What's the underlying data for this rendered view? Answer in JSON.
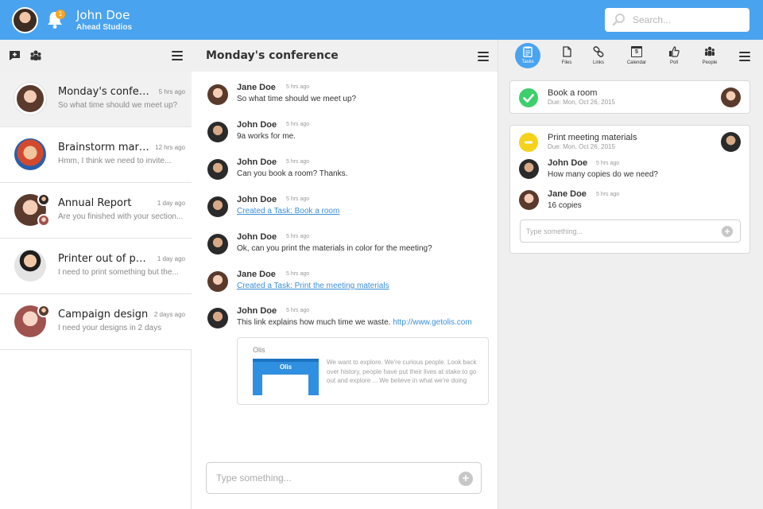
{
  "header": {
    "user_name": "John Doe",
    "company": "Ahead Studios",
    "notification_count": "1",
    "search_placeholder": "Search..."
  },
  "conversations": [
    {
      "title": "Monday's conference",
      "time": "5 hrs ago",
      "preview": "So what time should we meet up?"
    },
    {
      "title": "Brainstorm marketing",
      "time": "12 hrs ago",
      "preview": "Hmm, I think we need to invite..."
    },
    {
      "title": "Annual Report",
      "time": "1 day ago",
      "preview": "Are you finished with your section..."
    },
    {
      "title": "Printer out of paper",
      "time": "1 day ago",
      "preview": "I need to print something but the..."
    },
    {
      "title": "Campaign design",
      "time": "2 days ago",
      "preview": "I need your designs in 2 days"
    }
  ],
  "chat": {
    "title": "Monday's conference",
    "messages": [
      {
        "author": "Jane Doe",
        "time": "5 hrs ago",
        "text": "So what time should we meet up?"
      },
      {
        "author": "John Doe",
        "time": "5 hrs ago",
        "text": "9a works for me."
      },
      {
        "author": "John Doe",
        "time": "5 hrs ago",
        "text": "Can you book a room? Thanks."
      },
      {
        "author": "John Doe",
        "time": "5 hrs ago",
        "text": "Created a Task: Book a room"
      },
      {
        "author": "John Doe",
        "time": "5 hrs ago",
        "text": "Ok, can you print the materials in color for the meeting?"
      },
      {
        "author": "Jane Doe",
        "time": "5 hrs ago",
        "text": "Created a Task: Print the meeting materials"
      },
      {
        "author": "John Doe",
        "time": "5 hrs ago",
        "text": "This link explains how much time we waste.",
        "url": "http://www.getolis.com"
      }
    ],
    "link_preview": {
      "title": "Olis",
      "thumb_title": "Olis",
      "description": "We want to explore. We're curious people. Look back over history, people have put their lives at stake to go out and explore ... We believe in what we're doing"
    },
    "input_placeholder": "Type something..."
  },
  "tabs": [
    {
      "label": "Tasks",
      "icon": "clipboard-icon"
    },
    {
      "label": "Files",
      "icon": "file-icon"
    },
    {
      "label": "Links",
      "icon": "link-icon"
    },
    {
      "label": "Calendar",
      "icon": "calendar-icon",
      "day": "5"
    },
    {
      "label": "Poll",
      "icon": "thumbs-up-icon"
    },
    {
      "label": "People",
      "icon": "people-icon"
    }
  ],
  "tasks": [
    {
      "title": "Book a room",
      "due": "Due: Mon, Oct 26, 2015",
      "status": "done"
    },
    {
      "title": "Print meeting materials",
      "due": "Due: Mon, Oct 26, 2015",
      "status": "pending",
      "comments": [
        {
          "author": "John Doe",
          "time": "5 hrs ago",
          "text": "How many copies do we need?"
        },
        {
          "author": "Jane Doe",
          "time": "5 hrs ago",
          "text": "16 copies"
        }
      ],
      "input_placeholder": "Type something..."
    }
  ],
  "colors": {
    "brand": "#4aa3ee",
    "done": "#3ecf6d",
    "pending": "#f6d21a",
    "link": "#3b8fd9"
  }
}
